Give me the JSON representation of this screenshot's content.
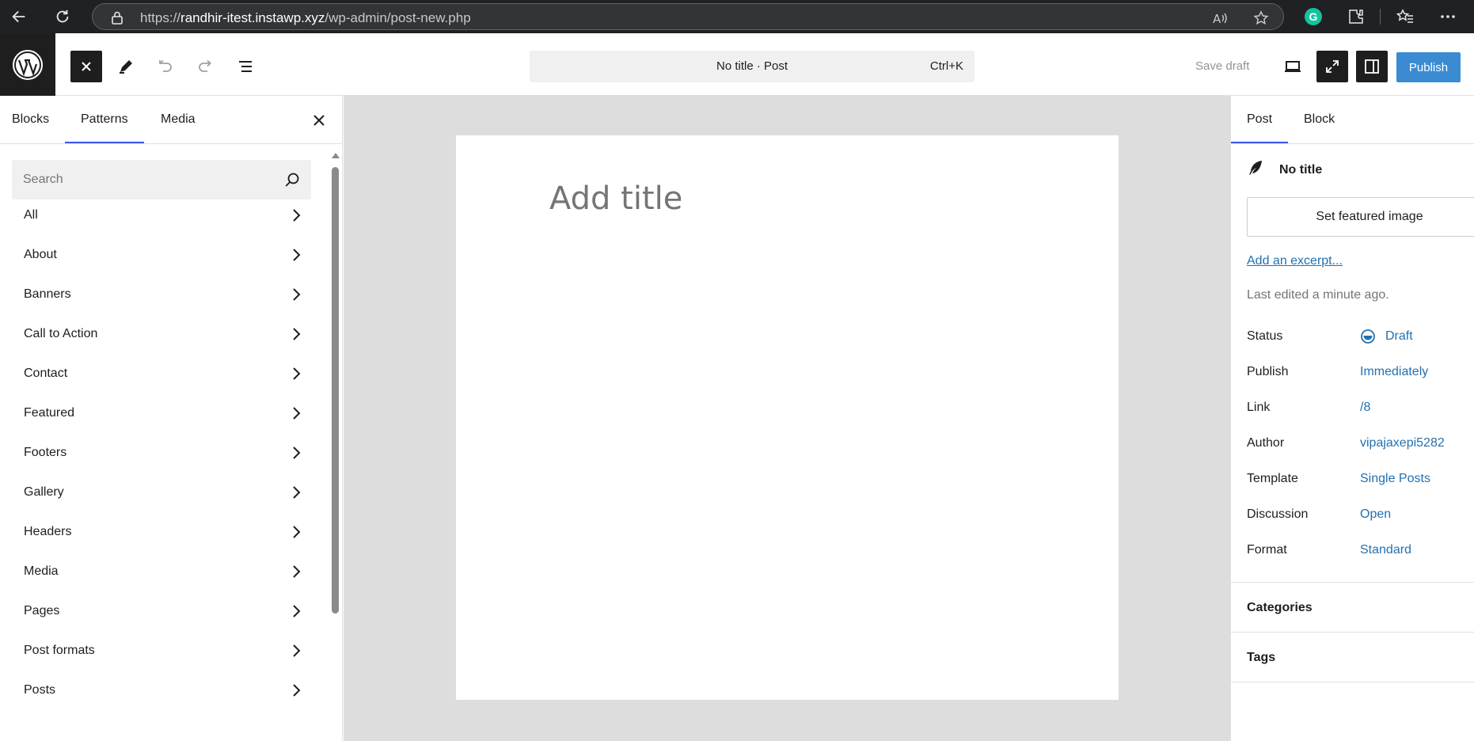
{
  "browser": {
    "url_scheme": "https://",
    "url_host": "randhir-itest.instawp.xyz",
    "url_path": "/wp-admin/post-new.php"
  },
  "toolbar": {
    "command_title": "No title · Post",
    "command_shortcut": "Ctrl+K",
    "save_draft_label": "Save draft",
    "publish_label": "Publish"
  },
  "inserter": {
    "tabs": [
      "Blocks",
      "Patterns",
      "Media"
    ],
    "active_tab": "Patterns",
    "search_placeholder": "Search",
    "categories": [
      "All",
      "About",
      "Banners",
      "Call to Action",
      "Contact",
      "Featured",
      "Footers",
      "Gallery",
      "Headers",
      "Media",
      "Pages",
      "Post formats",
      "Posts"
    ]
  },
  "canvas": {
    "title_placeholder": "Add title"
  },
  "settings": {
    "tabs": [
      "Post",
      "Block"
    ],
    "active_tab": "Post",
    "post_title": "No title",
    "featured_image_label": "Set featured image",
    "excerpt_link": "Add an excerpt...",
    "last_edited": "Last edited a minute ago.",
    "meta": [
      {
        "label": "Status",
        "value": "Draft"
      },
      {
        "label": "Publish",
        "value": "Immediately"
      },
      {
        "label": "Link",
        "value": "/8"
      },
      {
        "label": "Author",
        "value": "vipajaxepi5282"
      },
      {
        "label": "Template",
        "value": "Single Posts"
      },
      {
        "label": "Discussion",
        "value": "Open"
      },
      {
        "label": "Format",
        "value": "Standard"
      }
    ],
    "sections": [
      "Categories",
      "Tags"
    ]
  },
  "colors": {
    "accent": "#3858e9",
    "link": "#2271b1",
    "publish": "#3a8bd1",
    "dark": "#1e1e1e"
  }
}
